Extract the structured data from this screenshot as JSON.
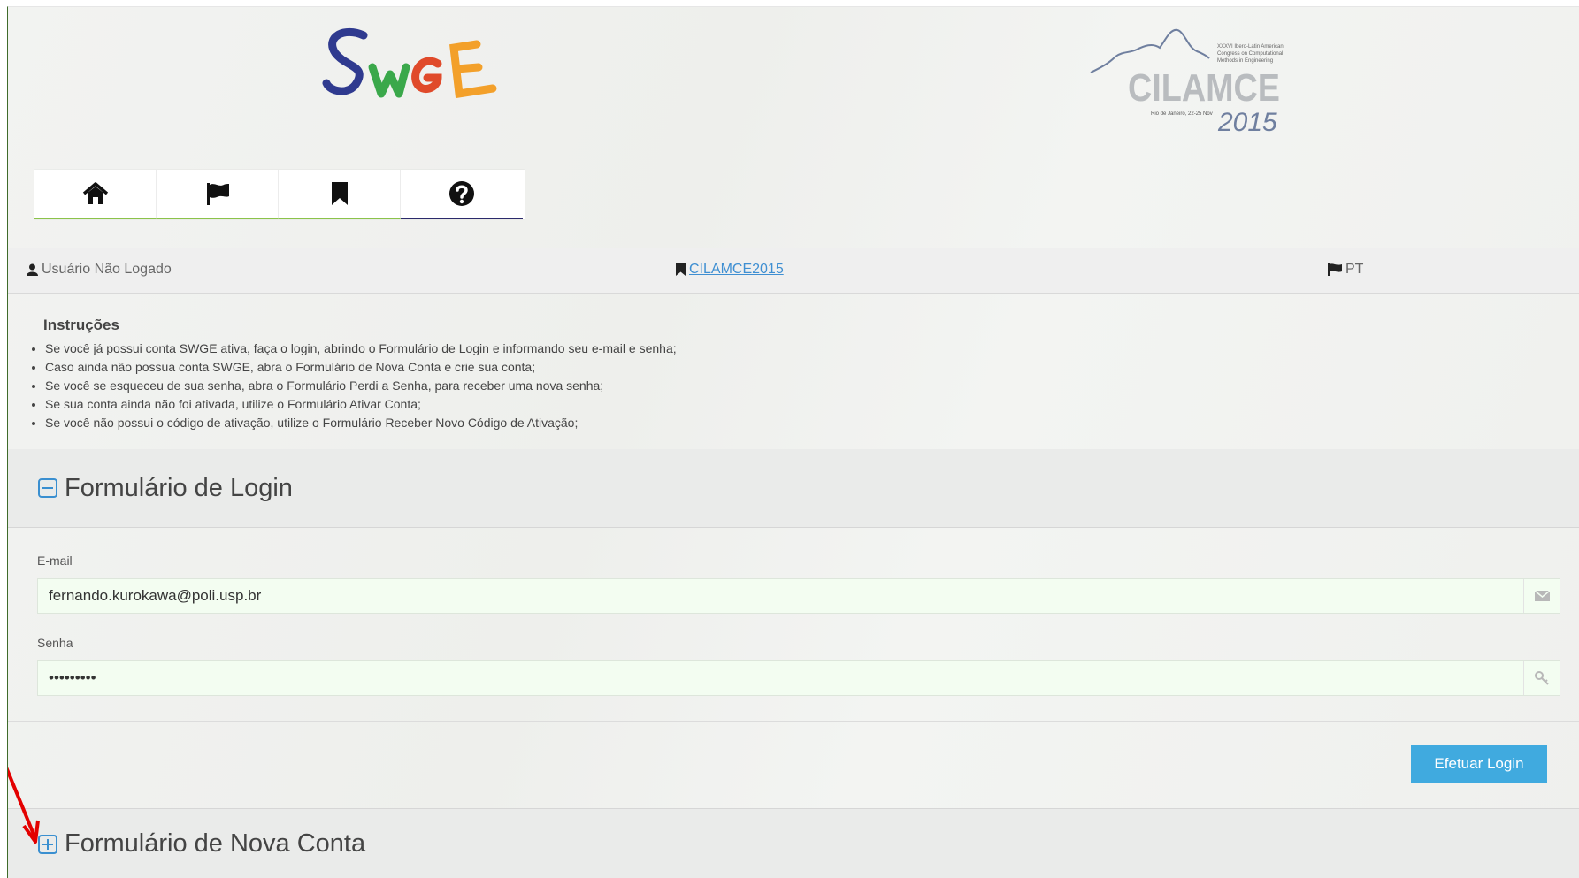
{
  "header": {
    "swge_logo_text": "SWGE",
    "cilamce_logo": {
      "name": "CILAMCE",
      "year": "2015",
      "subtitle_lines": [
        "XXXVI Ibero-Latin American",
        "Congress on Computational",
        "Methods in Engineering"
      ],
      "place_date": "Rio de Janeiro, 22-25 Nov"
    }
  },
  "nav": [
    {
      "icon": "home-icon"
    },
    {
      "icon": "flag-icon"
    },
    {
      "icon": "bookmark-icon"
    },
    {
      "icon": "help-icon"
    }
  ],
  "status": {
    "user": "Usuário Não Logado",
    "event_link": "CILAMCE2015",
    "language": "PT"
  },
  "instructions": {
    "title": "Instruções",
    "items": [
      "Se você já possui conta SWGE ativa, faça o login, abrindo o Formulário de Login e informando seu e-mail e senha;",
      "Caso ainda não possua conta SWGE, abra o Formulário de Nova Conta e crie sua conta;",
      "Se você se esqueceu de sua senha, abra o Formulário Perdi a Senha, para receber uma nova senha;",
      "Se sua conta ainda não foi ativada, utilize o Formulário Ativar Conta;",
      "Se você não possui o código de ativação, utilize o Formulário Receber Novo Código de Ativação;"
    ]
  },
  "login_form": {
    "title": "Formulário de Login",
    "email_label": "E-mail",
    "email_value": "fernando.kurokawa@poli.usp.br",
    "password_label": "Senha",
    "password_value": "•••••••••",
    "submit_label": "Efetuar Login"
  },
  "new_account_form": {
    "title": "Formulário de Nova Conta"
  },
  "colors": {
    "button": "#40aadf",
    "toggle": "#3a8fd0",
    "nav_underline": "#8bc34a",
    "annotation_arrow": "#e30000"
  }
}
